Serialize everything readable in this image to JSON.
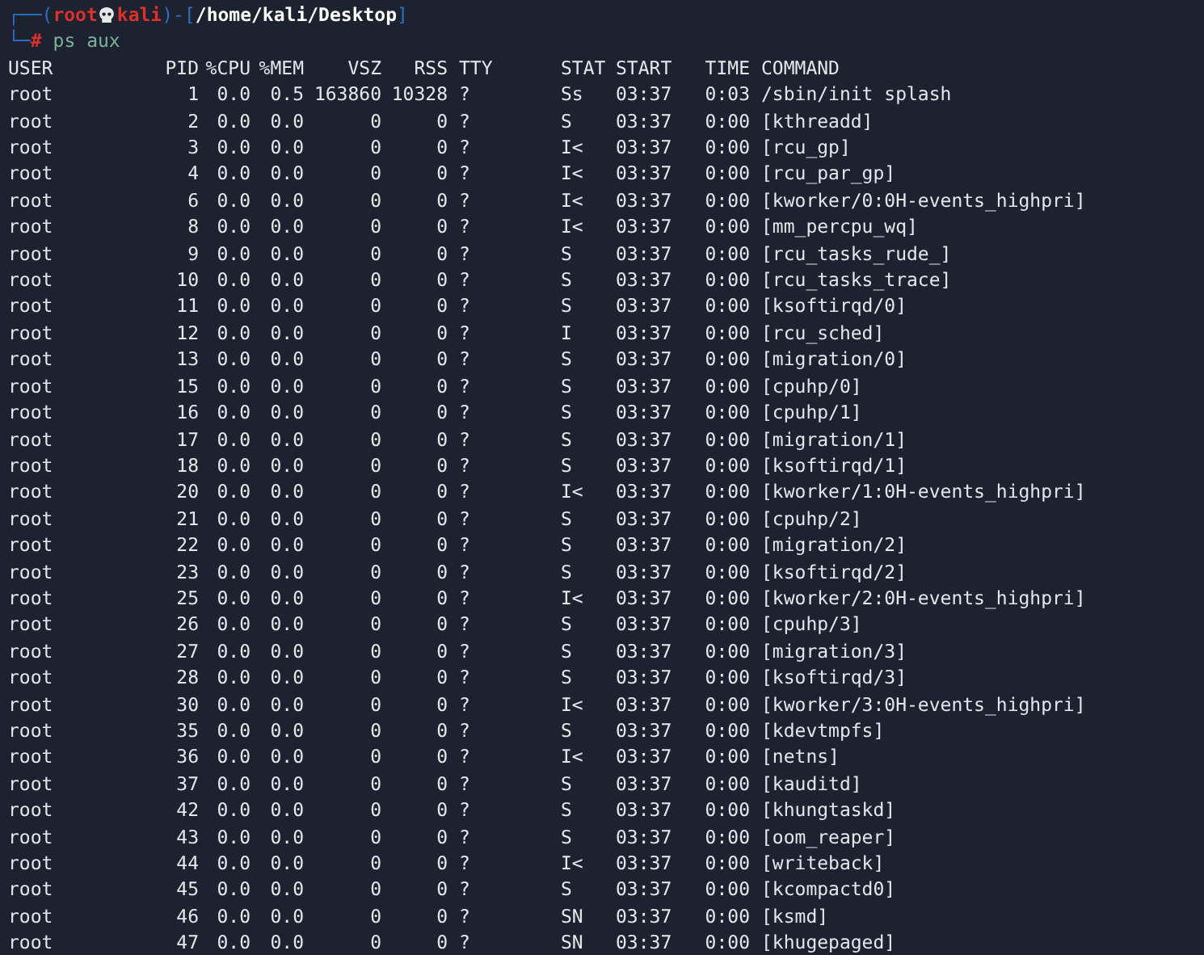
{
  "prompt": {
    "open": "┌──(",
    "user": "root",
    "host": "kali",
    "sep": ")-[",
    "path": "/home/kali/Desktop",
    "close": "]",
    "corner": "└─",
    "symbol": "#",
    "command": "ps aux"
  },
  "table": {
    "columns": [
      "USER",
      "PID",
      "%CPU",
      "%MEM",
      "VSZ",
      "RSS",
      "TTY",
      "STAT",
      "START",
      "TIME",
      "COMMAND"
    ],
    "rows": [
      [
        "root",
        "1",
        "0.0",
        "0.5",
        "163860",
        "10328",
        "?",
        "Ss",
        "03:37",
        "0:03",
        "/sbin/init splash"
      ],
      [
        "root",
        "2",
        "0.0",
        "0.0",
        "0",
        "0",
        "?",
        "S",
        "03:37",
        "0:00",
        "[kthreadd]"
      ],
      [
        "root",
        "3",
        "0.0",
        "0.0",
        "0",
        "0",
        "?",
        "I<",
        "03:37",
        "0:00",
        "[rcu_gp]"
      ],
      [
        "root",
        "4",
        "0.0",
        "0.0",
        "0",
        "0",
        "?",
        "I<",
        "03:37",
        "0:00",
        "[rcu_par_gp]"
      ],
      [
        "root",
        "6",
        "0.0",
        "0.0",
        "0",
        "0",
        "?",
        "I<",
        "03:37",
        "0:00",
        "[kworker/0:0H-events_highpri]"
      ],
      [
        "root",
        "8",
        "0.0",
        "0.0",
        "0",
        "0",
        "?",
        "I<",
        "03:37",
        "0:00",
        "[mm_percpu_wq]"
      ],
      [
        "root",
        "9",
        "0.0",
        "0.0",
        "0",
        "0",
        "?",
        "S",
        "03:37",
        "0:00",
        "[rcu_tasks_rude_]"
      ],
      [
        "root",
        "10",
        "0.0",
        "0.0",
        "0",
        "0",
        "?",
        "S",
        "03:37",
        "0:00",
        "[rcu_tasks_trace]"
      ],
      [
        "root",
        "11",
        "0.0",
        "0.0",
        "0",
        "0",
        "?",
        "S",
        "03:37",
        "0:00",
        "[ksoftirqd/0]"
      ],
      [
        "root",
        "12",
        "0.0",
        "0.0",
        "0",
        "0",
        "?",
        "I",
        "03:37",
        "0:00",
        "[rcu_sched]"
      ],
      [
        "root",
        "13",
        "0.0",
        "0.0",
        "0",
        "0",
        "?",
        "S",
        "03:37",
        "0:00",
        "[migration/0]"
      ],
      [
        "root",
        "15",
        "0.0",
        "0.0",
        "0",
        "0",
        "?",
        "S",
        "03:37",
        "0:00",
        "[cpuhp/0]"
      ],
      [
        "root",
        "16",
        "0.0",
        "0.0",
        "0",
        "0",
        "?",
        "S",
        "03:37",
        "0:00",
        "[cpuhp/1]"
      ],
      [
        "root",
        "17",
        "0.0",
        "0.0",
        "0",
        "0",
        "?",
        "S",
        "03:37",
        "0:00",
        "[migration/1]"
      ],
      [
        "root",
        "18",
        "0.0",
        "0.0",
        "0",
        "0",
        "?",
        "S",
        "03:37",
        "0:00",
        "[ksoftirqd/1]"
      ],
      [
        "root",
        "20",
        "0.0",
        "0.0",
        "0",
        "0",
        "?",
        "I<",
        "03:37",
        "0:00",
        "[kworker/1:0H-events_highpri]"
      ],
      [
        "root",
        "21",
        "0.0",
        "0.0",
        "0",
        "0",
        "?",
        "S",
        "03:37",
        "0:00",
        "[cpuhp/2]"
      ],
      [
        "root",
        "22",
        "0.0",
        "0.0",
        "0",
        "0",
        "?",
        "S",
        "03:37",
        "0:00",
        "[migration/2]"
      ],
      [
        "root",
        "23",
        "0.0",
        "0.0",
        "0",
        "0",
        "?",
        "S",
        "03:37",
        "0:00",
        "[ksoftirqd/2]"
      ],
      [
        "root",
        "25",
        "0.0",
        "0.0",
        "0",
        "0",
        "?",
        "I<",
        "03:37",
        "0:00",
        "[kworker/2:0H-events_highpri]"
      ],
      [
        "root",
        "26",
        "0.0",
        "0.0",
        "0",
        "0",
        "?",
        "S",
        "03:37",
        "0:00",
        "[cpuhp/3]"
      ],
      [
        "root",
        "27",
        "0.0",
        "0.0",
        "0",
        "0",
        "?",
        "S",
        "03:37",
        "0:00",
        "[migration/3]"
      ],
      [
        "root",
        "28",
        "0.0",
        "0.0",
        "0",
        "0",
        "?",
        "S",
        "03:37",
        "0:00",
        "[ksoftirqd/3]"
      ],
      [
        "root",
        "30",
        "0.0",
        "0.0",
        "0",
        "0",
        "?",
        "I<",
        "03:37",
        "0:00",
        "[kworker/3:0H-events_highpri]"
      ],
      [
        "root",
        "35",
        "0.0",
        "0.0",
        "0",
        "0",
        "?",
        "S",
        "03:37",
        "0:00",
        "[kdevtmpfs]"
      ],
      [
        "root",
        "36",
        "0.0",
        "0.0",
        "0",
        "0",
        "?",
        "I<",
        "03:37",
        "0:00",
        "[netns]"
      ],
      [
        "root",
        "37",
        "0.0",
        "0.0",
        "0",
        "0",
        "?",
        "S",
        "03:37",
        "0:00",
        "[kauditd]"
      ],
      [
        "root",
        "42",
        "0.0",
        "0.0",
        "0",
        "0",
        "?",
        "S",
        "03:37",
        "0:00",
        "[khungtaskd]"
      ],
      [
        "root",
        "43",
        "0.0",
        "0.0",
        "0",
        "0",
        "?",
        "S",
        "03:37",
        "0:00",
        "[oom_reaper]"
      ],
      [
        "root",
        "44",
        "0.0",
        "0.0",
        "0",
        "0",
        "?",
        "I<",
        "03:37",
        "0:00",
        "[writeback]"
      ],
      [
        "root",
        "45",
        "0.0",
        "0.0",
        "0",
        "0",
        "?",
        "S",
        "03:37",
        "0:00",
        "[kcompactd0]"
      ],
      [
        "root",
        "46",
        "0.0",
        "0.0",
        "0",
        "0",
        "?",
        "SN",
        "03:37",
        "0:00",
        "[ksmd]"
      ],
      [
        "root",
        "47",
        "0.0",
        "0.0",
        "0",
        "0",
        "?",
        "SN",
        "03:37",
        "0:00",
        "[khugepaged]"
      ]
    ]
  }
}
